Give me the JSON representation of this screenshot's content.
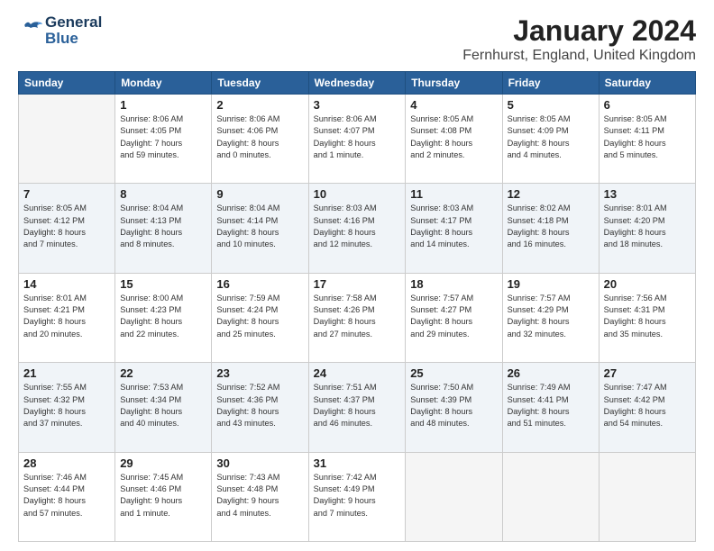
{
  "logo": {
    "line1": "General",
    "line2": "Blue"
  },
  "title": "January 2024",
  "location": "Fernhurst, England, United Kingdom",
  "headers": [
    "Sunday",
    "Monday",
    "Tuesday",
    "Wednesday",
    "Thursday",
    "Friday",
    "Saturday"
  ],
  "weeks": [
    [
      {
        "day": "",
        "info": ""
      },
      {
        "day": "1",
        "info": "Sunrise: 8:06 AM\nSunset: 4:05 PM\nDaylight: 7 hours\nand 59 minutes."
      },
      {
        "day": "2",
        "info": "Sunrise: 8:06 AM\nSunset: 4:06 PM\nDaylight: 8 hours\nand 0 minutes."
      },
      {
        "day": "3",
        "info": "Sunrise: 8:06 AM\nSunset: 4:07 PM\nDaylight: 8 hours\nand 1 minute."
      },
      {
        "day": "4",
        "info": "Sunrise: 8:05 AM\nSunset: 4:08 PM\nDaylight: 8 hours\nand 2 minutes."
      },
      {
        "day": "5",
        "info": "Sunrise: 8:05 AM\nSunset: 4:09 PM\nDaylight: 8 hours\nand 4 minutes."
      },
      {
        "day": "6",
        "info": "Sunrise: 8:05 AM\nSunset: 4:11 PM\nDaylight: 8 hours\nand 5 minutes."
      }
    ],
    [
      {
        "day": "7",
        "info": "Sunrise: 8:05 AM\nSunset: 4:12 PM\nDaylight: 8 hours\nand 7 minutes."
      },
      {
        "day": "8",
        "info": "Sunrise: 8:04 AM\nSunset: 4:13 PM\nDaylight: 8 hours\nand 8 minutes."
      },
      {
        "day": "9",
        "info": "Sunrise: 8:04 AM\nSunset: 4:14 PM\nDaylight: 8 hours\nand 10 minutes."
      },
      {
        "day": "10",
        "info": "Sunrise: 8:03 AM\nSunset: 4:16 PM\nDaylight: 8 hours\nand 12 minutes."
      },
      {
        "day": "11",
        "info": "Sunrise: 8:03 AM\nSunset: 4:17 PM\nDaylight: 8 hours\nand 14 minutes."
      },
      {
        "day": "12",
        "info": "Sunrise: 8:02 AM\nSunset: 4:18 PM\nDaylight: 8 hours\nand 16 minutes."
      },
      {
        "day": "13",
        "info": "Sunrise: 8:01 AM\nSunset: 4:20 PM\nDaylight: 8 hours\nand 18 minutes."
      }
    ],
    [
      {
        "day": "14",
        "info": "Sunrise: 8:01 AM\nSunset: 4:21 PM\nDaylight: 8 hours\nand 20 minutes."
      },
      {
        "day": "15",
        "info": "Sunrise: 8:00 AM\nSunset: 4:23 PM\nDaylight: 8 hours\nand 22 minutes."
      },
      {
        "day": "16",
        "info": "Sunrise: 7:59 AM\nSunset: 4:24 PM\nDaylight: 8 hours\nand 25 minutes."
      },
      {
        "day": "17",
        "info": "Sunrise: 7:58 AM\nSunset: 4:26 PM\nDaylight: 8 hours\nand 27 minutes."
      },
      {
        "day": "18",
        "info": "Sunrise: 7:57 AM\nSunset: 4:27 PM\nDaylight: 8 hours\nand 29 minutes."
      },
      {
        "day": "19",
        "info": "Sunrise: 7:57 AM\nSunset: 4:29 PM\nDaylight: 8 hours\nand 32 minutes."
      },
      {
        "day": "20",
        "info": "Sunrise: 7:56 AM\nSunset: 4:31 PM\nDaylight: 8 hours\nand 35 minutes."
      }
    ],
    [
      {
        "day": "21",
        "info": "Sunrise: 7:55 AM\nSunset: 4:32 PM\nDaylight: 8 hours\nand 37 minutes."
      },
      {
        "day": "22",
        "info": "Sunrise: 7:53 AM\nSunset: 4:34 PM\nDaylight: 8 hours\nand 40 minutes."
      },
      {
        "day": "23",
        "info": "Sunrise: 7:52 AM\nSunset: 4:36 PM\nDaylight: 8 hours\nand 43 minutes."
      },
      {
        "day": "24",
        "info": "Sunrise: 7:51 AM\nSunset: 4:37 PM\nDaylight: 8 hours\nand 46 minutes."
      },
      {
        "day": "25",
        "info": "Sunrise: 7:50 AM\nSunset: 4:39 PM\nDaylight: 8 hours\nand 48 minutes."
      },
      {
        "day": "26",
        "info": "Sunrise: 7:49 AM\nSunset: 4:41 PM\nDaylight: 8 hours\nand 51 minutes."
      },
      {
        "day": "27",
        "info": "Sunrise: 7:47 AM\nSunset: 4:42 PM\nDaylight: 8 hours\nand 54 minutes."
      }
    ],
    [
      {
        "day": "28",
        "info": "Sunrise: 7:46 AM\nSunset: 4:44 PM\nDaylight: 8 hours\nand 57 minutes."
      },
      {
        "day": "29",
        "info": "Sunrise: 7:45 AM\nSunset: 4:46 PM\nDaylight: 9 hours\nand 1 minute."
      },
      {
        "day": "30",
        "info": "Sunrise: 7:43 AM\nSunset: 4:48 PM\nDaylight: 9 hours\nand 4 minutes."
      },
      {
        "day": "31",
        "info": "Sunrise: 7:42 AM\nSunset: 4:49 PM\nDaylight: 9 hours\nand 7 minutes."
      },
      {
        "day": "",
        "info": ""
      },
      {
        "day": "",
        "info": ""
      },
      {
        "day": "",
        "info": ""
      }
    ]
  ]
}
